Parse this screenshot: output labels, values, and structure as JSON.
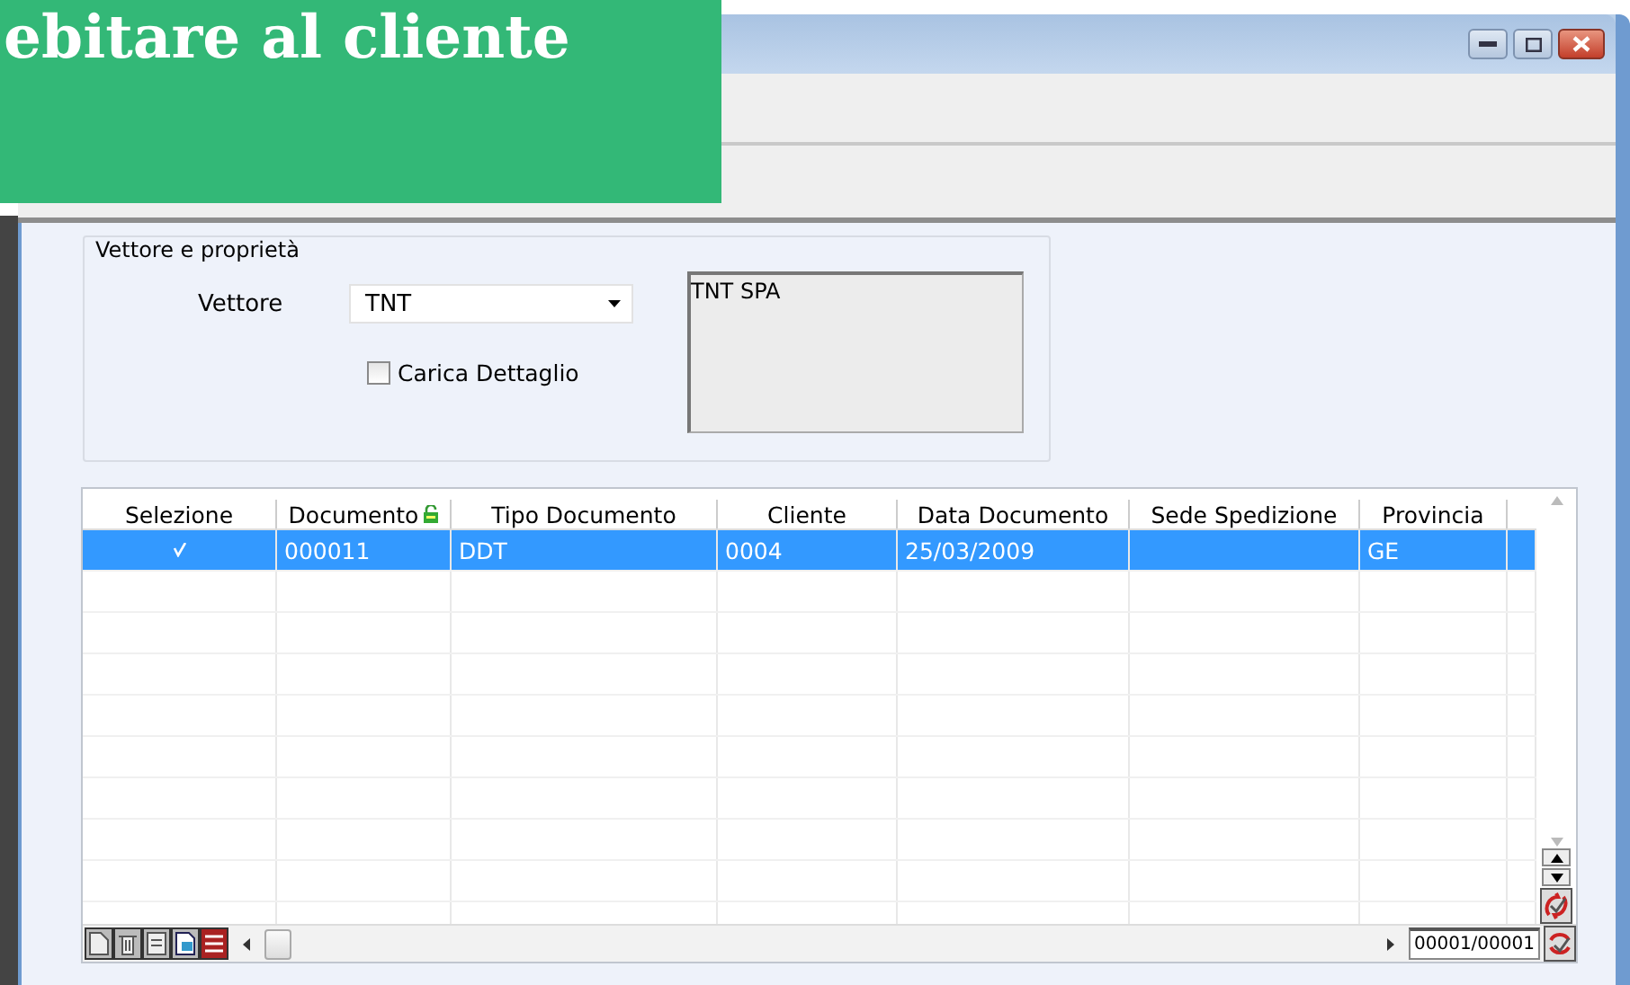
{
  "banner": {
    "text": "ebitare al cliente"
  },
  "group": {
    "title": "Vettore e proprietà",
    "vettore_label": "Vettore",
    "vettore_value": "TNT",
    "carrier_name": "TNT SPA",
    "detail_checkbox": {
      "label": "Carica Dettaglio",
      "checked": false
    }
  },
  "table": {
    "columns": [
      {
        "label": "Selezione",
        "lock": false
      },
      {
        "label": "Documento",
        "lock": true
      },
      {
        "label": "Tipo Documento",
        "lock": false
      },
      {
        "label": "Cliente",
        "lock": false
      },
      {
        "label": "Data Documento",
        "lock": false
      },
      {
        "label": "Sede Spedizione",
        "lock": false
      },
      {
        "label": "Provincia",
        "lock": false
      }
    ],
    "rows": [
      {
        "selected": true,
        "checked": true,
        "cells": [
          "",
          "000011",
          "DDT",
          "0004",
          "25/03/2009",
          "",
          "GE"
        ]
      }
    ]
  },
  "record_counter": "00001/00001"
}
